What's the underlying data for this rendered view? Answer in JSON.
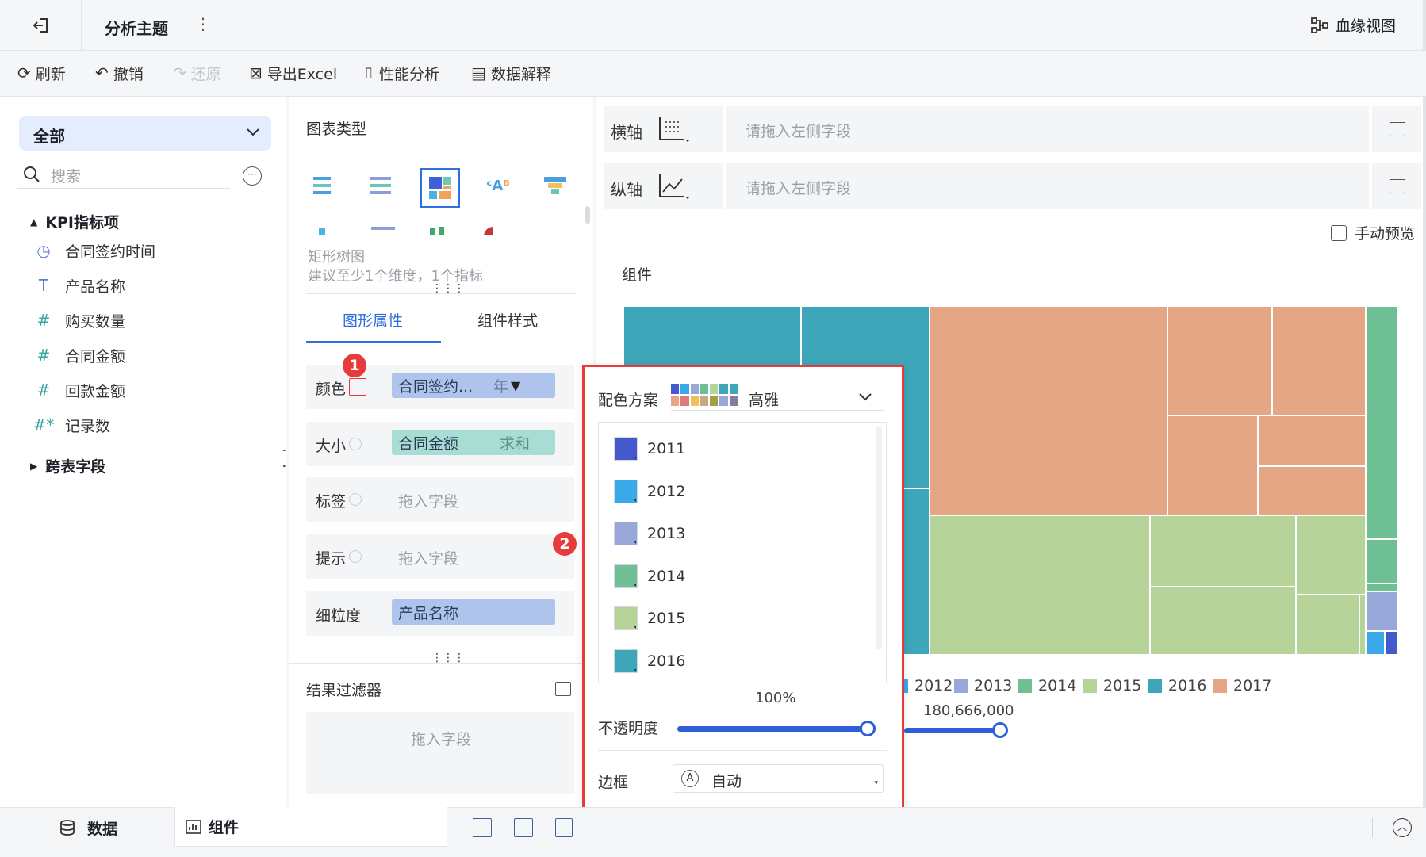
{
  "header": {
    "title": "分析主题",
    "more": "⋮",
    "lineage_label": "血缘视图"
  },
  "toolbar": {
    "refresh": "刷新",
    "undo": "撤销",
    "redo": "还原",
    "export": "导出Excel",
    "perf": "性能分析",
    "explain": "数据解释"
  },
  "fields": {
    "scope": "全部",
    "search_placeholder": "搜索",
    "group_kpi": "KPI指标项",
    "items": [
      {
        "icon": "clock-icon",
        "label": "合同签约时间"
      },
      {
        "icon": "text-icon",
        "label": "产品名称"
      },
      {
        "icon": "hash-icon",
        "label": "购买数量"
      },
      {
        "icon": "hash-icon",
        "label": "合同金额"
      },
      {
        "icon": "hash-icon",
        "label": "回款金额"
      },
      {
        "icon": "hash-star-icon",
        "label": "记录数"
      }
    ],
    "group_cross": "跨表字段"
  },
  "config": {
    "chart_type_title": "图表类型",
    "selected_chart": "矩形树图",
    "hint": "建议至少1个维度，1个指标",
    "tab_shape": "图形属性",
    "tab_style": "组件样式",
    "props": {
      "color_label": "颜色",
      "color_field": "合同签约...",
      "color_agg": "年",
      "size_label": "大小",
      "size_field": "合同金额",
      "size_agg": "求和",
      "label_label": "标签",
      "label_ph": "拖入字段",
      "tip_label": "提示",
      "tip_ph": "拖入字段",
      "gran_label": "细粒度",
      "gran_field": "产品名称"
    },
    "filter_title": "结果过滤器",
    "filter_ph": "拖入字段"
  },
  "axes": {
    "x_label": "横轴",
    "y_label": "纵轴",
    "x_ph": "请拖入左侧字段",
    "y_ph": "请拖入左侧字段",
    "manual_preview": "手动预览"
  },
  "canvas": {
    "title": "组件",
    "size_value": "180,666,000"
  },
  "legend": [
    {
      "label": "2011",
      "color": "#4359cc"
    },
    {
      "label": "2012",
      "color": "#3aa9ea"
    },
    {
      "label": "2013",
      "color": "#98a8d8"
    },
    {
      "label": "2014",
      "color": "#6fbf94"
    },
    {
      "label": "2015",
      "color": "#b6d39a"
    },
    {
      "label": "2016",
      "color": "#3ea6b9"
    },
    {
      "label": "2017",
      "color": "#e5a686"
    }
  ],
  "popup": {
    "scheme_label": "配色方案",
    "scheme_name": "高雅",
    "items": [
      {
        "label": "2011",
        "color": "#4359cc"
      },
      {
        "label": "2012",
        "color": "#3aa9ea"
      },
      {
        "label": "2013",
        "color": "#98a8d8"
      },
      {
        "label": "2014",
        "color": "#6fbf94"
      },
      {
        "label": "2015",
        "color": "#b6d39a"
      },
      {
        "label": "2016",
        "color": "#3ea6b9"
      }
    ],
    "opacity_label": "不透明度",
    "opacity_value": "100%",
    "opacity_fraction": 1.0,
    "border_label": "边框",
    "border_value": "自动"
  },
  "bottom": {
    "tab_data": "数据",
    "tab_component": "组件"
  },
  "badges": {
    "b1": "1",
    "b2": "2"
  }
}
